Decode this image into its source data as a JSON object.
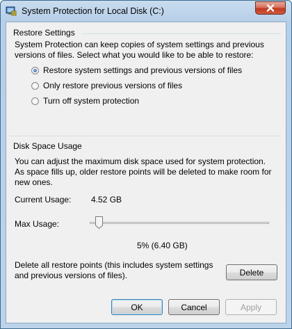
{
  "window": {
    "title": "System Protection for Local Disk (C:)"
  },
  "restore_settings": {
    "group_label": "Restore Settings",
    "description": "System Protection can keep copies of system settings and previous versions of files. Select what you would like to be able to restore:",
    "options": [
      {
        "label": "Restore system settings and previous versions of files",
        "checked": true
      },
      {
        "label": "Only restore previous versions of files",
        "checked": false
      },
      {
        "label": "Turn off system protection",
        "checked": false
      }
    ]
  },
  "disk_space": {
    "group_label": "Disk Space Usage",
    "description": "You can adjust the maximum disk space used for system protection. As space fills up, older restore points will be deleted to make room for new ones.",
    "current_usage_label": "Current Usage:",
    "current_usage_value": "4.52 GB",
    "max_usage_label": "Max Usage:",
    "max_usage_percent": 5,
    "max_usage_display": "5% (6.40 GB)",
    "delete_description": "Delete all restore points (this includes system settings and previous versions of files).",
    "delete_button": "Delete"
  },
  "footer": {
    "ok": "OK",
    "cancel": "Cancel",
    "apply": "Apply"
  }
}
